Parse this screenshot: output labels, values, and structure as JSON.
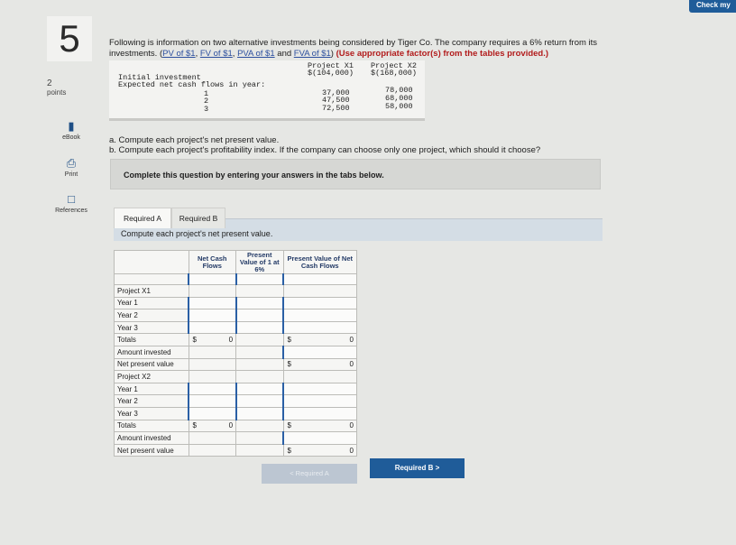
{
  "header": {
    "check_label": "Check my"
  },
  "question": {
    "number": "5",
    "points_value": "2",
    "points_label": "points",
    "intro_text": "Following is information on two alternative investments being considered by Tiger Co. The company requires a 6% return from its investments.",
    "links": [
      "PV of $1",
      "FV of $1",
      "PVA of $1",
      "FVA of $1"
    ],
    "links_sep": ", ",
    "links_and": " and ",
    "instruction": "(Use appropriate factor(s) from the tables provided.)",
    "tasks": [
      "a. Compute each project's net present value.",
      "b. Compute each project's profitability index. If the company can choose only one project, which should it choose?"
    ]
  },
  "tools": [
    {
      "label": "eBook",
      "icon": "book-icon"
    },
    {
      "label": "Print",
      "icon": "printer-icon"
    },
    {
      "label": "References",
      "icon": "references-icon"
    }
  ],
  "data_table": {
    "col1": "Project X1",
    "col2": "Project X2",
    "initial_label": "Initial investment",
    "initial_x1": "$(104,000)",
    "initial_x2": "$(168,000)",
    "flows_label": "Expected net cash flows in year:",
    "years": [
      "1",
      "2",
      "3"
    ],
    "x1": [
      "37,000",
      "47,500",
      "72,500"
    ],
    "x2": [
      "78,000",
      "68,000",
      "58,000"
    ]
  },
  "panel": {
    "text": "Complete this question by entering your answers in the tabs below."
  },
  "tabs": {
    "a": "Required A",
    "b": "Required B",
    "instruction": "Compute each project's net present value."
  },
  "grid": {
    "headers": [
      "Net Cash Flows",
      "Present Value of 1 at 6%",
      "Present Value of Net Cash Flows"
    ],
    "rows1": [
      "Project X1",
      "Year 1",
      "Year 2",
      "Year 3",
      "Totals",
      "Amount invested",
      "Net present value"
    ],
    "rows2": [
      "Project X2",
      "Year 1",
      "Year 2",
      "Year 3",
      "Totals",
      "Amount invested",
      "Net present value"
    ],
    "currency": "$",
    "zero": "0"
  },
  "nav": {
    "prev": "< Required A",
    "next": "Required B  >"
  }
}
